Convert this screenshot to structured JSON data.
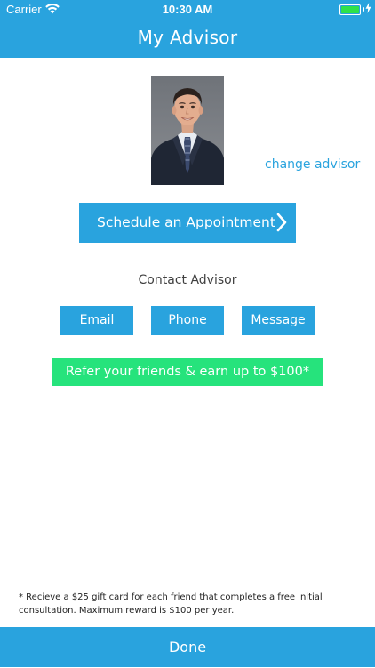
{
  "status_bar": {
    "carrier": "Carrier",
    "time": "10:30 AM",
    "icons": [
      "wifi-icon",
      "battery-icon",
      "charging-bolt-icon"
    ],
    "battery_color": "#2ee24a"
  },
  "nav": {
    "title": "My Advisor",
    "background_color": "#29a3de"
  },
  "advisor": {
    "photo_description_icon": "advisor-photo",
    "change_link": "change advisor"
  },
  "schedule": {
    "label": "Schedule an Appointment",
    "icon": "chevron-right-icon"
  },
  "contact": {
    "label": "Contact Advisor",
    "buttons": [
      {
        "label": "Email"
      },
      {
        "label": "Phone"
      },
      {
        "label": "Message"
      }
    ]
  },
  "referral": {
    "label": "Refer your friends & earn up to $100*",
    "color": "#26e37c"
  },
  "footnote": {
    "line1": "* Recieve a $25 gift card for each friend that completes a free initial",
    "line2": "consultation.  Maximum reward is $100 per year."
  },
  "done": {
    "label": "Done"
  }
}
